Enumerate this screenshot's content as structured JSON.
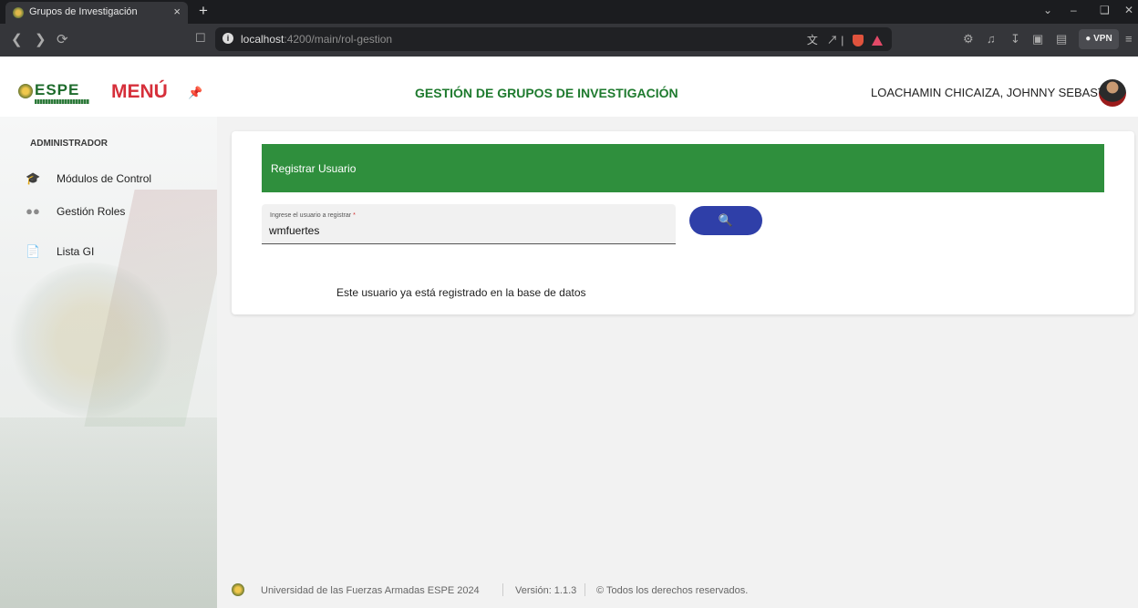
{
  "browser": {
    "tab_title": "Grupos de Investigación",
    "tab_close": "×",
    "new_tab": "+",
    "url_host": "localhost",
    "url_path": ":4200/main/rol-gestion",
    "vpn_label": "VPN"
  },
  "header": {
    "logo_text": "ESPE",
    "menu_label": "MENÚ",
    "app_title": "GESTIÓN DE GRUPOS DE INVESTIGACIÓN",
    "user_name": "LOACHAMIN CHICAIZA, JOHNNY SEBASTIAN"
  },
  "sidebar": {
    "section": "ADMINISTRADOR",
    "items": [
      {
        "label": "Módulos de Control",
        "icon": "graduation-cap-icon"
      },
      {
        "label": "Gestión Roles",
        "icon": "users-icon"
      },
      {
        "label": "Lista GI",
        "icon": "document-icon"
      }
    ]
  },
  "card": {
    "header": "Registrar Usuario",
    "field_label": "Ingrese el usuario a registrar",
    "field_required": "*",
    "field_value": "wmfuertes",
    "message": "Este usuario ya está registrado en la base de datos"
  },
  "footer": {
    "org": "Universidad de las Fuerzas Armadas ESPE 2024",
    "version": "Versión: 1.1.3",
    "rights": "© Todos los derechos reservados."
  },
  "colors": {
    "accent_green": "#2f8f3d",
    "menu_red": "#d62f3a",
    "search_button": "#2f3fa8"
  }
}
